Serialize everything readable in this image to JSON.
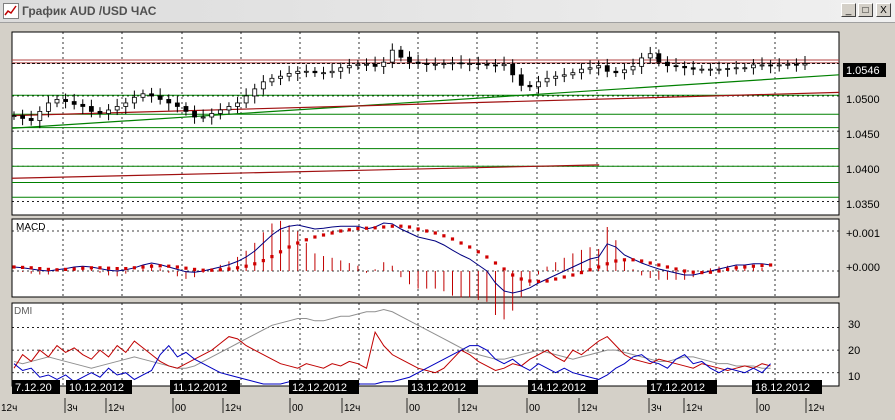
{
  "window": {
    "title": "График AUD /USD  ЧАС",
    "buttons": [
      "_",
      "□",
      "X"
    ]
  },
  "chart_data": {
    "type": "candlestick",
    "price_panel": {
      "ticks": [
        "1.0500",
        "1.0450",
        "1.0400",
        "1.0350"
      ],
      "tick_values": [
        1.05,
        1.045,
        1.04,
        1.035
      ],
      "current_price": "1.0546",
      "current_value": 1.0546,
      "ylim": [
        1.0335,
        1.0588
      ],
      "closes": [
        1.0472,
        1.0468,
        1.0465,
        1.0478,
        1.049,
        1.0495,
        1.0492,
        1.0488,
        1.0485,
        1.0478,
        1.0475,
        1.048,
        1.0485,
        1.049,
        1.0498,
        1.0503,
        1.05,
        1.0495,
        1.049,
        1.0485,
        1.0478,
        1.047,
        1.047,
        1.0475,
        1.048,
        1.0485,
        1.049,
        1.05,
        1.051,
        1.052,
        1.0525,
        1.0528,
        1.0532,
        1.0535,
        1.0535,
        1.0533,
        1.0533,
        1.0535,
        1.054,
        1.0543,
        1.0545,
        1.0545,
        1.0542,
        1.0548,
        1.0565,
        1.0555,
        1.0548,
        1.0546,
        1.0545,
        1.0545,
        1.0546,
        1.0547,
        1.0546,
        1.0546,
        1.0545,
        1.0544,
        1.0543,
        1.0545,
        1.053,
        1.0515,
        1.0513,
        1.052,
        1.0525,
        1.0528,
        1.053,
        1.0533,
        1.0538,
        1.054,
        1.0543,
        1.0535,
        1.0533,
        1.0537,
        1.0542,
        1.0554,
        1.056,
        1.0548,
        1.0543,
        1.0542,
        1.054,
        1.0538,
        1.0538,
        1.0538,
        1.0538,
        1.0539,
        1.054,
        1.054,
        1.0544,
        1.0544,
        1.0543,
        1.0544,
        1.0545,
        1.0544,
        1.0546
      ],
      "hlines_red": [
        1.0551,
        1.0547
      ],
      "hlines_green": [
        1.0501,
        1.0474,
        1.0455,
        1.0425,
        1.04,
        1.0377,
        1.0356
      ],
      "trendlines": [
        {
          "color": "#008000",
          "from": [
            0,
            1.0454
          ],
          "to": [
            1,
            1.053
          ]
        },
        {
          "color": "#a01010",
          "from": [
            0,
            1.0472
          ],
          "to": [
            1,
            1.0505
          ]
        },
        {
          "color": "#a01010",
          "from": [
            0,
            1.0383
          ],
          "to": [
            0.71,
            1.0402
          ]
        }
      ]
    },
    "macd_panel": {
      "label": "MACD",
      "ticks": [
        "+0.001",
        "+0.000"
      ],
      "tick_values": [
        0.001,
        0.0
      ],
      "ylim": [
        -0.0006,
        0.00125
      ],
      "macd_line": [
        0.0001,
        8e-05,
        5e-05,
        2e-05,
        0.0,
        3e-05,
        6e-05,
        0.0001,
        0.00012,
        0.0001,
        6e-05,
        2e-05,
        0.0,
        3e-05,
        8e-05,
        0.00015,
        0.0002,
        0.00016,
        0.0001,
        4e-05,
        -2e-05,
        -3e-05,
        0.0,
        5e-05,
        0.0001,
        0.00016,
        0.00024,
        0.00035,
        0.0005,
        0.0007,
        0.0009,
        0.00105,
        0.00112,
        0.00115,
        0.0011,
        0.00105,
        0.00107,
        0.0011,
        0.00112,
        0.00112,
        0.00112,
        0.00105,
        0.0011,
        0.0012,
        0.00118,
        0.00105,
        0.00095,
        0.00085,
        0.0008,
        0.00075,
        0.00065,
        0.00052,
        0.0004,
        0.0003,
        0.00015,
        0.0,
        -0.0003,
        -0.0005,
        -0.00055,
        -0.0005,
        -0.00042,
        -0.0003,
        -0.0002,
        -0.0001,
        0.0,
        0.0001,
        0.0002,
        0.0003,
        0.00035,
        0.00068,
        0.0006,
        0.0004,
        0.0003,
        0.0002,
        0.00012,
        5e-05,
        0.0,
        -5e-05,
        -0.0001,
        -0.0001,
        -5e-05,
        0.0,
        5e-05,
        0.0001,
        0.00015,
        0.00015,
        0.00018,
        0.00018,
        0.00015
      ],
      "signal_line": [
        0.0001,
        9e-05,
        8e-05,
        6e-05,
        4e-05,
        3e-05,
        4e-05,
        5e-05,
        7e-05,
        8e-05,
        8e-05,
        7e-05,
        6e-05,
        6e-05,
        8e-05,
        0.0001,
        0.00012,
        0.00013,
        0.00012,
        0.0001,
        7e-05,
        4e-05,
        2e-05,
        2e-05,
        3e-05,
        5e-05,
        8e-05,
        0.00012,
        0.00018,
        0.00026,
        0.00036,
        0.00048,
        0.0006,
        0.0007,
        0.00078,
        0.00085,
        0.0009,
        0.00095,
        0.001,
        0.00103,
        0.00106,
        0.00107,
        0.00108,
        0.0011,
        0.00112,
        0.00112,
        0.0011,
        0.00105,
        0.001,
        0.00095,
        0.00088,
        0.0008,
        0.0007,
        0.0006,
        0.00048,
        0.00035,
        0.0002,
        5e-05,
        -0.0001,
        -0.0002,
        -0.00025,
        -0.00026,
        -0.00025,
        -0.0002,
        -0.00015,
        -0.0001,
        -4e-05,
        3e-05,
        0.0001,
        0.00018,
        0.00025,
        0.00028,
        0.00028,
        0.00025,
        0.0002,
        0.00015,
        0.0001,
        5e-05,
        0.0,
        -3e-05,
        -4e-05,
        -3e-05,
        0.0,
        4e-05,
        8e-05,
        0.0001,
        0.00012,
        0.00014,
        0.00015
      ]
    },
    "dmi_panel": {
      "label": "DMI",
      "ticks": [
        "30",
        "20",
        "10"
      ],
      "tick_values": [
        30,
        20,
        10
      ],
      "ylim": [
        5,
        40
      ],
      "adx_line": [
        15,
        14,
        15,
        16,
        17,
        16,
        15,
        14,
        13,
        12,
        13,
        14,
        15,
        16,
        17,
        16,
        15,
        14,
        13,
        12,
        12,
        13,
        15,
        17,
        19,
        21,
        23,
        25,
        27,
        29,
        31,
        32,
        33,
        34,
        34,
        33,
        33,
        34,
        35,
        35,
        36,
        37,
        37,
        38,
        37,
        35,
        33,
        31,
        29,
        27,
        25,
        23,
        21,
        19,
        18,
        17,
        16,
        16,
        17,
        18,
        19,
        20,
        19,
        18,
        17,
        16,
        17,
        18,
        19,
        20,
        20,
        19,
        18,
        17,
        16,
        15,
        15,
        16,
        17,
        17,
        16,
        15,
        14,
        14,
        13,
        13,
        13,
        12,
        12
      ],
      "plus_di": [
        12,
        18,
        15,
        20,
        17,
        22,
        19,
        21,
        18,
        16,
        20,
        17,
        22,
        19,
        24,
        21,
        18,
        15,
        13,
        12,
        14,
        16,
        18,
        20,
        23,
        26,
        25,
        22,
        20,
        18,
        16,
        14,
        13,
        12,
        14,
        13,
        12,
        14,
        13,
        15,
        14,
        12,
        28,
        22,
        18,
        16,
        14,
        12,
        11,
        10,
        12,
        16,
        20,
        18,
        15,
        13,
        11,
        12,
        14,
        13,
        16,
        18,
        20,
        17,
        15,
        20,
        18,
        21,
        24,
        26,
        22,
        18,
        16,
        15,
        14,
        16,
        15,
        14,
        13,
        12,
        14,
        13,
        12,
        11,
        12,
        13,
        12,
        14,
        13
      ],
      "minus_di": [
        14,
        11,
        12,
        8,
        9,
        7,
        9,
        6,
        8,
        10,
        8,
        12,
        9,
        10,
        7,
        9,
        11,
        18,
        22,
        17,
        19,
        16,
        14,
        12,
        10,
        9,
        8,
        7,
        6,
        5,
        5,
        5,
        6,
        5,
        6,
        5,
        6,
        5,
        5,
        6,
        5,
        5,
        5,
        6,
        6,
        7,
        8,
        10,
        12,
        14,
        16,
        18,
        20,
        22,
        22,
        20,
        16,
        14,
        16,
        13,
        11,
        14,
        12,
        10,
        12,
        10,
        9,
        8,
        7,
        9,
        12,
        14,
        17,
        18,
        15,
        14,
        12,
        16,
        18,
        14,
        15,
        12,
        10,
        12,
        11,
        10,
        12,
        10,
        14
      ]
    },
    "date_labels": [
      "7.12.20",
      "10.12.2012",
      "11.12.2012",
      "12.12.2012",
      "13.12.2012",
      "14.12.2012",
      "17.12.2012",
      "18.12.2012"
    ],
    "time_labels": [
      "12ч",
      "3ч",
      "12ч",
      "00",
      "12ч",
      "00",
      "12ч",
      "00",
      "12ч",
      "00",
      "12ч",
      "3ч",
      "12ч",
      "00",
      "12ч"
    ]
  }
}
